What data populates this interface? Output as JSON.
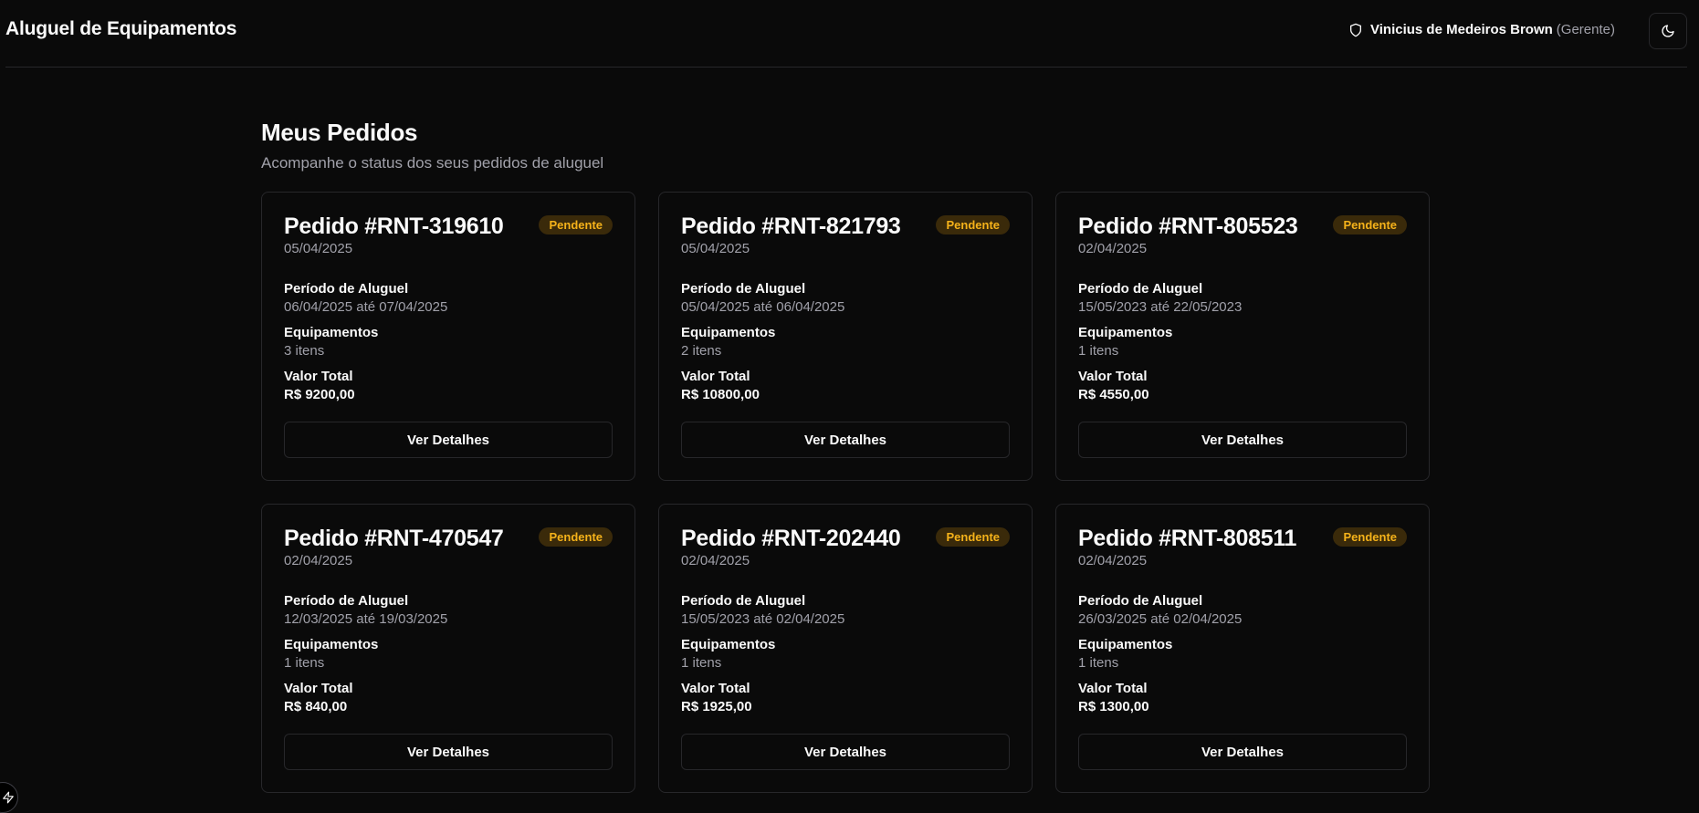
{
  "header": {
    "app_title": "Aluguel de Equipamentos",
    "user_name": "Vinicius de Medeiros Brown",
    "user_role": "(Gerente)",
    "shield_icon": "shield-icon",
    "theme_icon": "moon-icon"
  },
  "page": {
    "title": "Meus Pedidos",
    "subtitle": "Acompanhe o status dos seus pedidos de aluguel"
  },
  "labels": {
    "period": "Período de Aluguel",
    "equipment": "Equipamentos",
    "total": "Valor Total",
    "details_button": "Ver Detalhes"
  },
  "colors": {
    "background": "#0a0a0a",
    "border": "#27272a",
    "badge_bg": "#3a2a0a",
    "badge_text": "#f5b21a",
    "muted": "#a1a1aa"
  },
  "orders": [
    {
      "title": "Pedido #RNT-319610",
      "date": "05/04/2025",
      "status": "Pendente",
      "period": "06/04/2025 até 07/04/2025",
      "items": "3 itens",
      "total": "R$ 9200,00"
    },
    {
      "title": "Pedido #RNT-821793",
      "date": "05/04/2025",
      "status": "Pendente",
      "period": "05/04/2025 até 06/04/2025",
      "items": "2 itens",
      "total": "R$ 10800,00"
    },
    {
      "title": "Pedido #RNT-805523",
      "date": "02/04/2025",
      "status": "Pendente",
      "period": "15/05/2023 até 22/05/2023",
      "items": "1 itens",
      "total": "R$ 4550,00"
    },
    {
      "title": "Pedido #RNT-470547",
      "date": "02/04/2025",
      "status": "Pendente",
      "period": "12/03/2025 até 19/03/2025",
      "items": "1 itens",
      "total": "R$ 840,00"
    },
    {
      "title": "Pedido #RNT-202440",
      "date": "02/04/2025",
      "status": "Pendente",
      "period": "15/05/2023 até 02/04/2025",
      "items": "1 itens",
      "total": "R$ 1925,00"
    },
    {
      "title": "Pedido #RNT-808511",
      "date": "02/04/2025",
      "status": "Pendente",
      "period": "26/03/2025 até 02/04/2025",
      "items": "1 itens",
      "total": "R$ 1300,00"
    }
  ]
}
